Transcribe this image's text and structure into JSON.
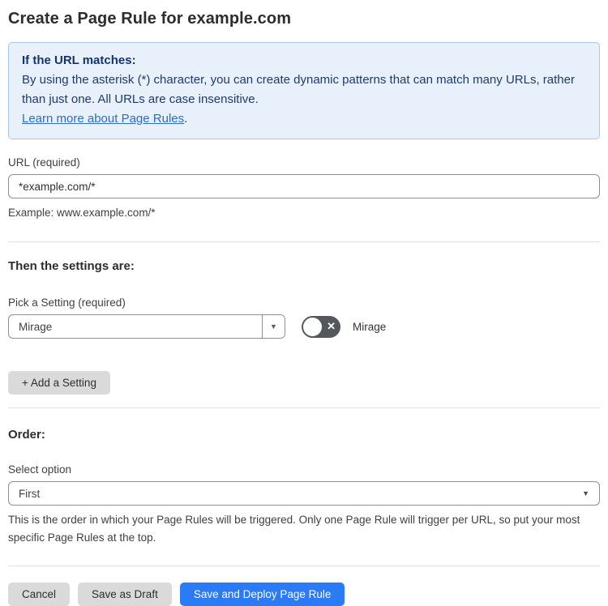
{
  "page_title": "Create a Page Rule for example.com",
  "info_box": {
    "heading": "If the URL matches:",
    "body": "By using the asterisk (*) character, you can create dynamic patterns that can match many URLs, rather than just one. All URLs are case insensitive.",
    "link_label": "Learn more about Page Rules",
    "link_suffix": "."
  },
  "url_field": {
    "label": "URL (required)",
    "value": "*example.com/*",
    "helper": "Example: www.example.com/*"
  },
  "settings_section": {
    "heading": "Then the settings are:",
    "pick_label": "Pick a Setting (required)",
    "selected_setting": "Mirage",
    "toggle_label": "Mirage",
    "toggle_state": "off",
    "add_setting_label": "+ Add a Setting"
  },
  "order_section": {
    "heading": "Order:",
    "select_label": "Select option",
    "selected_option": "First",
    "helper": "This is the order in which your Page Rules will be triggered. Only one Page Rule will trigger per URL, so put your most specific Page Rules at the top."
  },
  "footer": {
    "cancel_label": "Cancel",
    "save_draft_label": "Save as Draft",
    "save_deploy_label": "Save and Deploy Page Rule"
  },
  "icons": {
    "dropdown_arrow": "▼",
    "toggle_x": "✕"
  },
  "colors": {
    "accent_blue": "#2c7bf6",
    "info_bg": "#e8f1fb",
    "info_border": "#aac8ec",
    "info_text": "#1e3a6e",
    "link_blue": "#2d6cc4",
    "toggle_bg": "#54585c",
    "button_gray": "#dadada",
    "input_border": "#8f8f8f",
    "divider": "#e2e2e2"
  }
}
